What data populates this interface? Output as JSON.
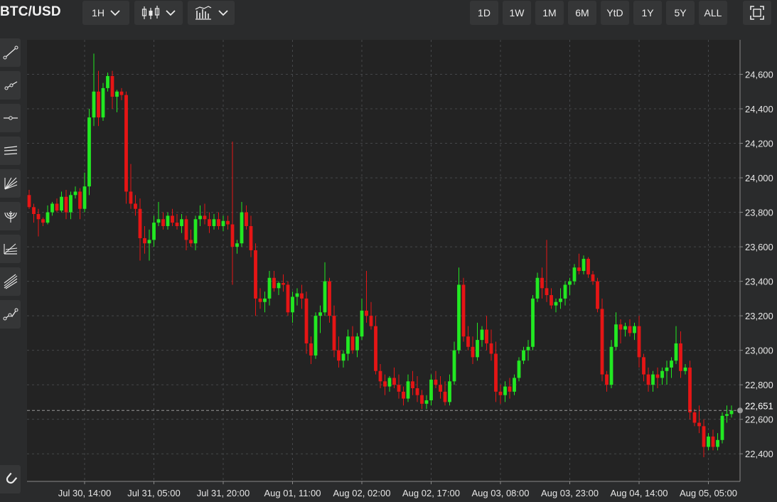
{
  "header": {
    "symbol": "BTC/USD",
    "interval_label": "1H",
    "ranges": [
      "1D",
      "1W",
      "1M",
      "6M",
      "YtD",
      "1Y",
      "5Y",
      "ALL"
    ]
  },
  "sidebar": {
    "tools": [
      "trend-line-icon",
      "ray-icon",
      "horizontal-line-icon",
      "parallel-channel-icon",
      "fan-icon",
      "arc-icon",
      "fibonacci-icon",
      "pitchfork-icon",
      "polyline-icon"
    ],
    "bottom_tool": "magnet-icon"
  },
  "colors": {
    "up": "#22e822",
    "down": "#e51515",
    "grid": "#45474a",
    "background": "#232323"
  },
  "chart_data": {
    "type": "candlestick",
    "title": "BTC/USD",
    "interval": "1H",
    "ylim": [
      22240,
      24800
    ],
    "y_ticks": [
      22400,
      22600,
      22800,
      23000,
      23200,
      23400,
      23600,
      23800,
      24000,
      24200,
      24400,
      24600
    ],
    "y_tick_labels": [
      "22,400",
      "22,600",
      "22,800",
      "23,000",
      "23,200",
      "23,400",
      "23,600",
      "23,800",
      "24,000",
      "24,200",
      "24,400",
      "24,600"
    ],
    "x_tick_labels": [
      "Jul 30, 14:00",
      "Jul 31, 05:00",
      "Jul 31, 20:00",
      "Aug 01, 11:00",
      "Aug 02, 02:00",
      "Aug 02, 17:00",
      "Aug 03, 08:00",
      "Aug 03, 23:00",
      "Aug 04, 14:00",
      "Aug 05, 05:00"
    ],
    "x_tick_index": [
      12,
      27,
      42,
      57,
      72,
      87,
      102,
      117,
      132,
      147
    ],
    "last_price": 22651,
    "last_price_label": "22,651",
    "grid": true,
    "candles": [
      [
        23900,
        23930,
        23820,
        23830
      ],
      [
        23830,
        23850,
        23740,
        23790
      ],
      [
        23790,
        23820,
        23660,
        23760
      ],
      [
        23760,
        23770,
        23720,
        23740
      ],
      [
        23740,
        23840,
        23730,
        23800
      ],
      [
        23800,
        23860,
        23780,
        23850
      ],
      [
        23850,
        23880,
        23800,
        23810
      ],
      [
        23810,
        23920,
        23800,
        23890
      ],
      [
        23890,
        23930,
        23760,
        23800
      ],
      [
        23800,
        23920,
        23760,
        23900
      ],
      [
        23900,
        23950,
        23880,
        23920
      ],
      [
        23920,
        23940,
        23760,
        23820
      ],
      [
        23820,
        24030,
        23800,
        23950
      ],
      [
        23950,
        24400,
        23900,
        24350
      ],
      [
        24350,
        24720,
        24300,
        24500
      ],
      [
        24500,
        24620,
        24300,
        24350
      ],
      [
        24350,
        24550,
        24330,
        24520
      ],
      [
        24520,
        24610,
        24500,
        24590
      ],
      [
        24590,
        24620,
        24400,
        24470
      ],
      [
        24470,
        24510,
        24380,
        24500
      ],
      [
        24500,
        24520,
        24450,
        24480
      ],
      [
        24480,
        24500,
        23850,
        23920
      ],
      [
        23920,
        24080,
        23820,
        23850
      ],
      [
        23850,
        23900,
        23780,
        23820
      ],
      [
        23820,
        23880,
        23520,
        23650
      ],
      [
        23650,
        23720,
        23560,
        23620
      ],
      [
        23620,
        23700,
        23520,
        23640
      ],
      [
        23640,
        23780,
        23600,
        23740
      ],
      [
        23740,
        23860,
        23720,
        23760
      ],
      [
        23760,
        23800,
        23700,
        23720
      ],
      [
        23720,
        23800,
        23700,
        23780
      ],
      [
        23780,
        23820,
        23720,
        23740
      ],
      [
        23740,
        23790,
        23700,
        23720
      ],
      [
        23720,
        23790,
        23680,
        23760
      ],
      [
        23760,
        23780,
        23580,
        23640
      ],
      [
        23640,
        23700,
        23600,
        23620
      ],
      [
        23620,
        23780,
        23580,
        23760
      ],
      [
        23760,
        23840,
        23720,
        23780
      ],
      [
        23780,
        23850,
        23730,
        23760
      ],
      [
        23760,
        23800,
        23680,
        23720
      ],
      [
        23720,
        23790,
        23700,
        23760
      ],
      [
        23760,
        23800,
        23700,
        23720
      ],
      [
        23720,
        23780,
        23690,
        23750
      ],
      [
        23750,
        23780,
        23700,
        23730
      ],
      [
        23730,
        24210,
        23380,
        23600
      ],
      [
        23600,
        23640,
        23560,
        23620
      ],
      [
        23620,
        23860,
        23600,
        23800
      ],
      [
        23800,
        23840,
        23700,
        23720
      ],
      [
        23720,
        23780,
        23540,
        23580
      ],
      [
        23580,
        23620,
        23200,
        23300
      ],
      [
        23300,
        23360,
        23240,
        23280
      ],
      [
        23280,
        23340,
        23220,
        23300
      ],
      [
        23300,
        23460,
        23260,
        23420
      ],
      [
        23420,
        23460,
        23340,
        23360
      ],
      [
        23360,
        23400,
        23320,
        23390
      ],
      [
        23390,
        23440,
        23340,
        23380
      ],
      [
        23380,
        23400,
        23200,
        23220
      ],
      [
        23220,
        23340,
        23160,
        23310
      ],
      [
        23310,
        23360,
        23260,
        23330
      ],
      [
        23330,
        23380,
        23240,
        23300
      ],
      [
        23300,
        23340,
        22980,
        23040
      ],
      [
        23040,
        23080,
        22920,
        22970
      ],
      [
        22970,
        23220,
        22950,
        23200
      ],
      [
        23200,
        23260,
        23100,
        23220
      ],
      [
        23220,
        23510,
        23200,
        23400
      ],
      [
        23400,
        23420,
        23160,
        23200
      ],
      [
        23200,
        23260,
        22960,
        23000
      ],
      [
        23000,
        23080,
        22900,
        22940
      ],
      [
        22940,
        23000,
        22900,
        22980
      ],
      [
        22980,
        23120,
        22940,
        23080
      ],
      [
        23080,
        23140,
        22980,
        23000
      ],
      [
        23000,
        23100,
        22960,
        23080
      ],
      [
        23080,
        23300,
        23060,
        23230
      ],
      [
        23230,
        23460,
        23160,
        23200
      ],
      [
        23200,
        23280,
        23120,
        23140
      ],
      [
        23140,
        23200,
        22860,
        22880
      ],
      [
        22880,
        22920,
        22780,
        22820
      ],
      [
        22820,
        22860,
        22740,
        22790
      ],
      [
        22790,
        22850,
        22760,
        22840
      ],
      [
        22840,
        22900,
        22780,
        22800
      ],
      [
        22800,
        22860,
        22720,
        22760
      ],
      [
        22760,
        22790,
        22680,
        22720
      ],
      [
        22720,
        22860,
        22700,
        22820
      ],
      [
        22820,
        22880,
        22740,
        22780
      ],
      [
        22780,
        22850,
        22700,
        22740
      ],
      [
        22740,
        22770,
        22660,
        22690
      ],
      [
        22690,
        22740,
        22660,
        22710
      ],
      [
        22710,
        22860,
        22680,
        22830
      ],
      [
        22830,
        22880,
        22780,
        22800
      ],
      [
        22800,
        22850,
        22720,
        22760
      ],
      [
        22760,
        22820,
        22680,
        22700
      ],
      [
        22700,
        22860,
        22680,
        22820
      ],
      [
        22820,
        23050,
        22800,
        23000
      ],
      [
        23000,
        23480,
        22980,
        23380
      ],
      [
        23380,
        23420,
        23050,
        23080
      ],
      [
        23080,
        23140,
        23000,
        23020
      ],
      [
        23020,
        23080,
        22920,
        22960
      ],
      [
        22960,
        23160,
        22940,
        23060
      ],
      [
        23060,
        23140,
        23020,
        23120
      ],
      [
        23120,
        23200,
        23000,
        23040
      ],
      [
        23040,
        23120,
        22940,
        22980
      ],
      [
        22980,
        23050,
        22700,
        22760
      ],
      [
        22760,
        22800,
        22690,
        22740
      ],
      [
        22740,
        22820,
        22700,
        22790
      ],
      [
        22790,
        22840,
        22720,
        22760
      ],
      [
        22760,
        22860,
        22740,
        22840
      ],
      [
        22840,
        22960,
        22820,
        22940
      ],
      [
        22940,
        23020,
        22920,
        23000
      ],
      [
        23000,
        23060,
        22940,
        23020
      ],
      [
        23020,
        23320,
        23000,
        23300
      ],
      [
        23300,
        23450,
        23280,
        23420
      ],
      [
        23420,
        23480,
        23300,
        23360
      ],
      [
        23360,
        23640,
        23280,
        23320
      ],
      [
        23320,
        23360,
        23240,
        23260
      ],
      [
        23260,
        23300,
        23220,
        23280
      ],
      [
        23280,
        23360,
        23240,
        23300
      ],
      [
        23300,
        23400,
        23260,
        23380
      ],
      [
        23380,
        23420,
        23320,
        23400
      ],
      [
        23400,
        23500,
        23380,
        23480
      ],
      [
        23480,
        23560,
        23440,
        23460
      ],
      [
        23460,
        23550,
        23440,
        23530
      ],
      [
        23530,
        23540,
        23420,
        23440
      ],
      [
        23440,
        23460,
        23380,
        23400
      ],
      [
        23400,
        23420,
        23220,
        23240
      ],
      [
        23240,
        23300,
        22820,
        22860
      ],
      [
        22860,
        22880,
        22760,
        22800
      ],
      [
        22800,
        23060,
        22780,
        23020
      ],
      [
        23020,
        23220,
        23000,
        23150
      ],
      [
        23150,
        23180,
        23040,
        23120
      ],
      [
        23120,
        23160,
        23080,
        23140
      ],
      [
        23140,
        23180,
        23080,
        23100
      ],
      [
        23100,
        23160,
        23060,
        23140
      ],
      [
        23140,
        23200,
        22900,
        22960
      ],
      [
        22960,
        22980,
        22820,
        22860
      ],
      [
        22860,
        22900,
        22760,
        22800
      ],
      [
        22800,
        22880,
        22760,
        22860
      ],
      [
        22860,
        22900,
        22780,
        22840
      ],
      [
        22840,
        22900,
        22800,
        22880
      ],
      [
        22880,
        22940,
        22800,
        22900
      ],
      [
        22900,
        22960,
        22840,
        22940
      ],
      [
        22940,
        23140,
        22920,
        23040
      ],
      [
        23040,
        23110,
        22840,
        22880
      ],
      [
        22880,
        22920,
        22860,
        22900
      ],
      [
        22900,
        22940,
        22600,
        22640
      ],
      [
        22640,
        22660,
        22560,
        22580
      ],
      [
        22580,
        22680,
        22520,
        22560
      ],
      [
        22560,
        22600,
        22380,
        22440
      ],
      [
        22440,
        22520,
        22420,
        22500
      ],
      [
        22500,
        22540,
        22420,
        22440
      ],
      [
        22440,
        22520,
        22420,
        22480
      ],
      [
        22480,
        22640,
        22460,
        22620
      ],
      [
        22620,
        22680,
        22580,
        22630
      ],
      [
        22630,
        22680,
        22610,
        22651
      ]
    ]
  }
}
